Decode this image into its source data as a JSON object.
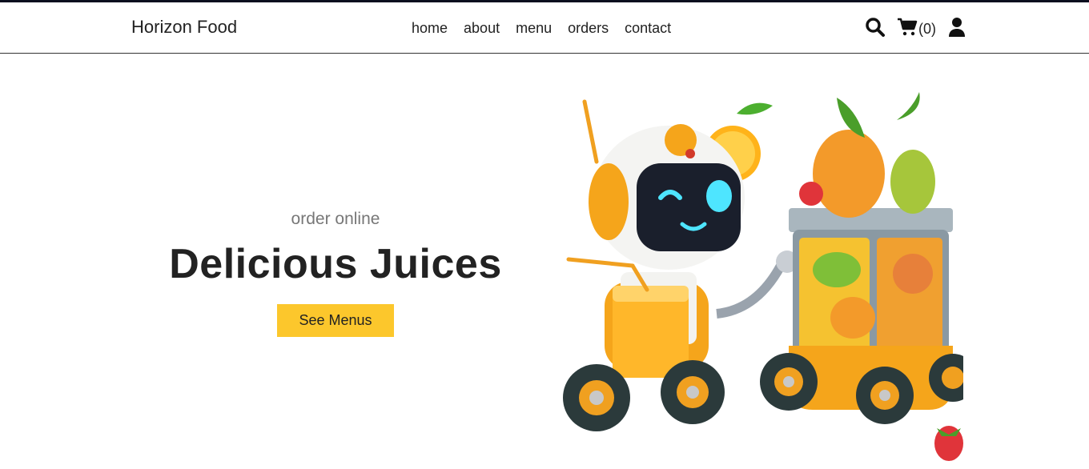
{
  "header": {
    "logo": "Horizon Food",
    "nav": [
      "home",
      "about",
      "menu",
      "orders",
      "contact"
    ],
    "cart_count": "(0)",
    "icons": [
      "search-icon",
      "cart-icon",
      "user-icon"
    ]
  },
  "hero": {
    "subtitle": "order online",
    "title": "Delicious Juices",
    "button": "See Menus",
    "accent": "#fcc72c"
  }
}
